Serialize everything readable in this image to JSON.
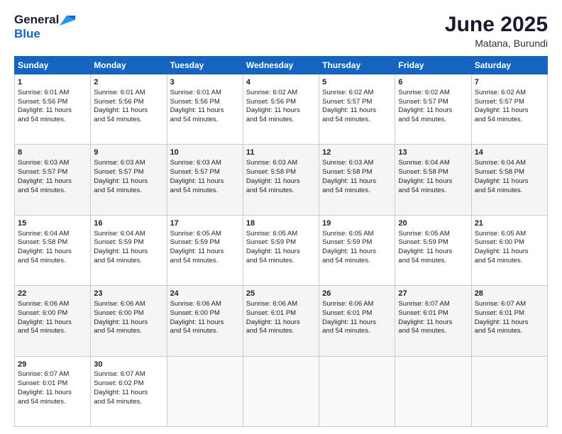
{
  "header": {
    "logo_general": "General",
    "logo_blue": "Blue",
    "month_title": "June 2025",
    "subtitle": "Matana, Burundi"
  },
  "weekdays": [
    "Sunday",
    "Monday",
    "Tuesday",
    "Wednesday",
    "Thursday",
    "Friday",
    "Saturday"
  ],
  "rows": [
    [
      {
        "day": "1",
        "line1": "Sunrise: 6:01 AM",
        "line2": "Sunset: 5:56 PM",
        "line3": "Daylight: 11 hours",
        "line4": "and 54 minutes."
      },
      {
        "day": "2",
        "line1": "Sunrise: 6:01 AM",
        "line2": "Sunset: 5:56 PM",
        "line3": "Daylight: 11 hours",
        "line4": "and 54 minutes."
      },
      {
        "day": "3",
        "line1": "Sunrise: 6:01 AM",
        "line2": "Sunset: 5:56 PM",
        "line3": "Daylight: 11 hours",
        "line4": "and 54 minutes."
      },
      {
        "day": "4",
        "line1": "Sunrise: 6:02 AM",
        "line2": "Sunset: 5:56 PM",
        "line3": "Daylight: 11 hours",
        "line4": "and 54 minutes."
      },
      {
        "day": "5",
        "line1": "Sunrise: 6:02 AM",
        "line2": "Sunset: 5:57 PM",
        "line3": "Daylight: 11 hours",
        "line4": "and 54 minutes."
      },
      {
        "day": "6",
        "line1": "Sunrise: 6:02 AM",
        "line2": "Sunset: 5:57 PM",
        "line3": "Daylight: 11 hours",
        "line4": "and 54 minutes."
      },
      {
        "day": "7",
        "line1": "Sunrise: 6:02 AM",
        "line2": "Sunset: 5:57 PM",
        "line3": "Daylight: 11 hours",
        "line4": "and 54 minutes."
      }
    ],
    [
      {
        "day": "8",
        "line1": "Sunrise: 6:03 AM",
        "line2": "Sunset: 5:57 PM",
        "line3": "Daylight: 11 hours",
        "line4": "and 54 minutes."
      },
      {
        "day": "9",
        "line1": "Sunrise: 6:03 AM",
        "line2": "Sunset: 5:57 PM",
        "line3": "Daylight: 11 hours",
        "line4": "and 54 minutes."
      },
      {
        "day": "10",
        "line1": "Sunrise: 6:03 AM",
        "line2": "Sunset: 5:57 PM",
        "line3": "Daylight: 11 hours",
        "line4": "and 54 minutes."
      },
      {
        "day": "11",
        "line1": "Sunrise: 6:03 AM",
        "line2": "Sunset: 5:58 PM",
        "line3": "Daylight: 11 hours",
        "line4": "and 54 minutes."
      },
      {
        "day": "12",
        "line1": "Sunrise: 6:03 AM",
        "line2": "Sunset: 5:58 PM",
        "line3": "Daylight: 11 hours",
        "line4": "and 54 minutes."
      },
      {
        "day": "13",
        "line1": "Sunrise: 6:04 AM",
        "line2": "Sunset: 5:58 PM",
        "line3": "Daylight: 11 hours",
        "line4": "and 54 minutes."
      },
      {
        "day": "14",
        "line1": "Sunrise: 6:04 AM",
        "line2": "Sunset: 5:58 PM",
        "line3": "Daylight: 11 hours",
        "line4": "and 54 minutes."
      }
    ],
    [
      {
        "day": "15",
        "line1": "Sunrise: 6:04 AM",
        "line2": "Sunset: 5:58 PM",
        "line3": "Daylight: 11 hours",
        "line4": "and 54 minutes."
      },
      {
        "day": "16",
        "line1": "Sunrise: 6:04 AM",
        "line2": "Sunset: 5:59 PM",
        "line3": "Daylight: 11 hours",
        "line4": "and 54 minutes."
      },
      {
        "day": "17",
        "line1": "Sunrise: 6:05 AM",
        "line2": "Sunset: 5:59 PM",
        "line3": "Daylight: 11 hours",
        "line4": "and 54 minutes."
      },
      {
        "day": "18",
        "line1": "Sunrise: 6:05 AM",
        "line2": "Sunset: 5:59 PM",
        "line3": "Daylight: 11 hours",
        "line4": "and 54 minutes."
      },
      {
        "day": "19",
        "line1": "Sunrise: 6:05 AM",
        "line2": "Sunset: 5:59 PM",
        "line3": "Daylight: 11 hours",
        "line4": "and 54 minutes."
      },
      {
        "day": "20",
        "line1": "Sunrise: 6:05 AM",
        "line2": "Sunset: 5:59 PM",
        "line3": "Daylight: 11 hours",
        "line4": "and 54 minutes."
      },
      {
        "day": "21",
        "line1": "Sunrise: 6:05 AM",
        "line2": "Sunset: 6:00 PM",
        "line3": "Daylight: 11 hours",
        "line4": "and 54 minutes."
      }
    ],
    [
      {
        "day": "22",
        "line1": "Sunrise: 6:06 AM",
        "line2": "Sunset: 6:00 PM",
        "line3": "Daylight: 11 hours",
        "line4": "and 54 minutes."
      },
      {
        "day": "23",
        "line1": "Sunrise: 6:06 AM",
        "line2": "Sunset: 6:00 PM",
        "line3": "Daylight: 11 hours",
        "line4": "and 54 minutes."
      },
      {
        "day": "24",
        "line1": "Sunrise: 6:06 AM",
        "line2": "Sunset: 6:00 PM",
        "line3": "Daylight: 11 hours",
        "line4": "and 54 minutes."
      },
      {
        "day": "25",
        "line1": "Sunrise: 6:06 AM",
        "line2": "Sunset: 6:01 PM",
        "line3": "Daylight: 11 hours",
        "line4": "and 54 minutes."
      },
      {
        "day": "26",
        "line1": "Sunrise: 6:06 AM",
        "line2": "Sunset: 6:01 PM",
        "line3": "Daylight: 11 hours",
        "line4": "and 54 minutes."
      },
      {
        "day": "27",
        "line1": "Sunrise: 6:07 AM",
        "line2": "Sunset: 6:01 PM",
        "line3": "Daylight: 11 hours",
        "line4": "and 54 minutes."
      },
      {
        "day": "28",
        "line1": "Sunrise: 6:07 AM",
        "line2": "Sunset: 6:01 PM",
        "line3": "Daylight: 11 hours",
        "line4": "and 54 minutes."
      }
    ],
    [
      {
        "day": "29",
        "line1": "Sunrise: 6:07 AM",
        "line2": "Sunset: 6:01 PM",
        "line3": "Daylight: 11 hours",
        "line4": "and 54 minutes."
      },
      {
        "day": "30",
        "line1": "Sunrise: 6:07 AM",
        "line2": "Sunset: 6:02 PM",
        "line3": "Daylight: 11 hours",
        "line4": "and 54 minutes."
      },
      {
        "day": "",
        "line1": "",
        "line2": "",
        "line3": "",
        "line4": ""
      },
      {
        "day": "",
        "line1": "",
        "line2": "",
        "line3": "",
        "line4": ""
      },
      {
        "day": "",
        "line1": "",
        "line2": "",
        "line3": "",
        "line4": ""
      },
      {
        "day": "",
        "line1": "",
        "line2": "",
        "line3": "",
        "line4": ""
      },
      {
        "day": "",
        "line1": "",
        "line2": "",
        "line3": "",
        "line4": ""
      }
    ]
  ]
}
